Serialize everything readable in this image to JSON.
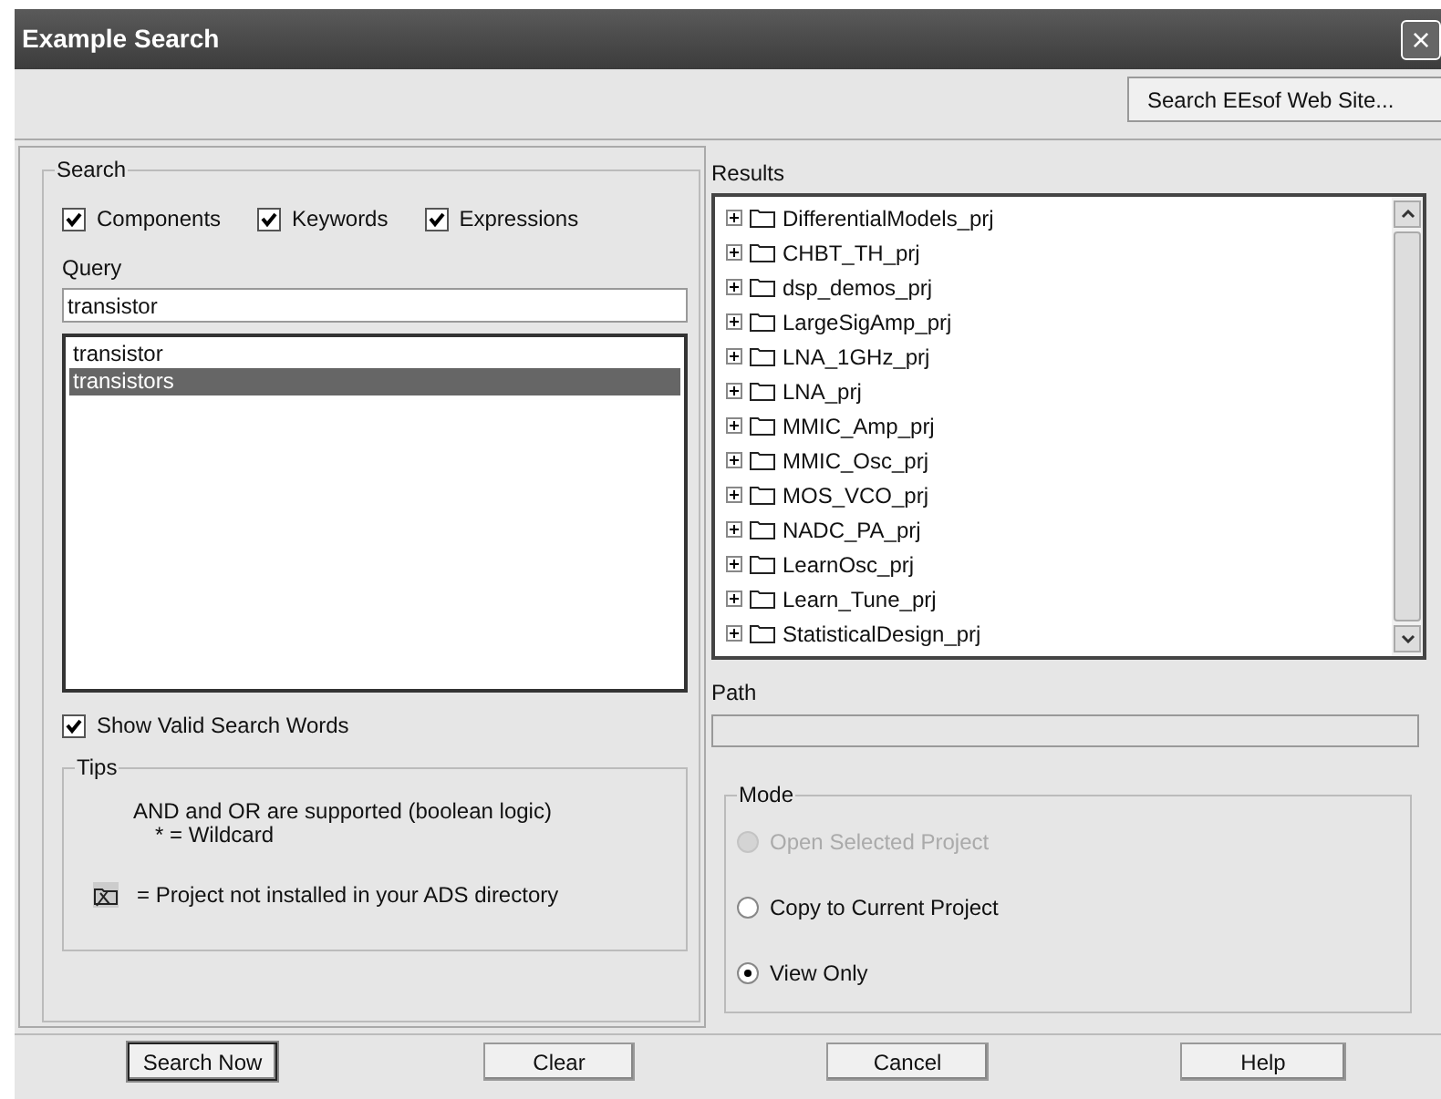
{
  "window": {
    "title": "Example Search",
    "close": "×"
  },
  "toolbar": {
    "web_button": "Search EEsof Web Site..."
  },
  "search": {
    "legend": "Search",
    "options": [
      {
        "label": "Components",
        "checked": true
      },
      {
        "label": "Keywords",
        "checked": true
      },
      {
        "label": "Expressions",
        "checked": true
      }
    ],
    "query_label": "Query",
    "query": "transistor",
    "suggestions": [
      {
        "text": "transistor",
        "selected": false
      },
      {
        "text": "transistors",
        "selected": true
      }
    ],
    "show_valid": {
      "label": "Show Valid Search Words",
      "checked": true
    }
  },
  "tips": {
    "legend": "Tips",
    "lines": [
      "AND and OR are supported (boolean logic)",
      "* = Wildcard"
    ],
    "icon_note": "= Project not installed in your ADS directory"
  },
  "results": {
    "label": "Results",
    "items": [
      {
        "name": "DifferentialModels_prj",
        "expanded": false
      },
      {
        "name": "CHBT_TH_prj",
        "expanded": false
      },
      {
        "name": "dsp_demos_prj",
        "expanded": false
      },
      {
        "name": "LargeSigAmp_prj",
        "expanded": false
      },
      {
        "name": "LNA_1GHz_prj",
        "expanded": false
      },
      {
        "name": "LNA_prj",
        "expanded": false
      },
      {
        "name": "MMIC_Amp_prj",
        "expanded": false
      },
      {
        "name": "MMIC_Osc_prj",
        "expanded": false
      },
      {
        "name": "MOS_VCO_prj",
        "expanded": false
      },
      {
        "name": "NADC_PA_prj",
        "expanded": false
      },
      {
        "name": "LearnOsc_prj",
        "expanded": false
      },
      {
        "name": "Learn_Tune_prj",
        "expanded": false
      },
      {
        "name": "StatisticalDesign_prj",
        "expanded": false
      }
    ]
  },
  "path": {
    "label": "Path"
  },
  "mode": {
    "legend": "Mode",
    "options": [
      {
        "label": "Open Selected Project",
        "selected": false,
        "disabled": true
      },
      {
        "label": "Copy to Current Project",
        "selected": false,
        "disabled": false
      },
      {
        "label": "View Only",
        "selected": true,
        "disabled": false
      }
    ]
  },
  "buttons": [
    {
      "label": "Search Now",
      "default": true
    },
    {
      "label": "Clear",
      "default": false
    },
    {
      "label": "Cancel",
      "default": false
    },
    {
      "label": "Help",
      "default": false
    }
  ]
}
